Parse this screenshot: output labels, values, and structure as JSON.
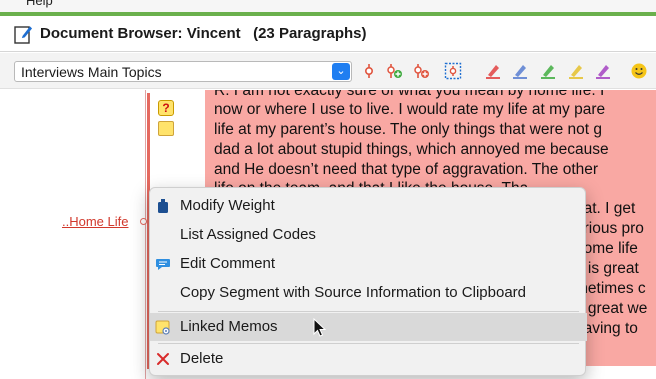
{
  "app_menu": {
    "label": "Help"
  },
  "window": {
    "title": "Document Browser: Vincent   (23 Paragraphs)"
  },
  "toolbar": {
    "code_system_select": "Interviews Main Topics",
    "highlight_colors": [
      "#e45b5b",
      "#6f8fd6",
      "#5cb85c",
      "#e7c84a",
      "#b05cc9"
    ]
  },
  "document": {
    "lines": [
      "R: I am not exactly sure of what you mean by home life. I",
      "now or where I use to live. I would rate my life at my pare",
      "life at my parent’s house. The only things that were not g",
      "dad a lot about stupid things, which annoyed me because",
      "and He doesn’t need that type of aggravation. The other",
      "life on the team, and that I like the house. Tha",
      "eat. I get",
      "erious pro",
      "home life",
      "e is great",
      "metimes c",
      "g great we",
      "having to"
    ],
    "highlight_color": "#f9a8a3",
    "code_label": "..Home Life"
  },
  "context_menu": {
    "items": [
      {
        "label": "Modify Weight",
        "icon": "weight-icon"
      },
      {
        "label": "List Assigned Codes",
        "icon": ""
      },
      {
        "label": "Edit Comment",
        "icon": "comment-icon"
      },
      {
        "label": "Copy Segment with Source Information to Clipboard",
        "icon": ""
      },
      {
        "label": "Linked Memos",
        "icon": "linked-memo-icon",
        "highlighted": true
      },
      {
        "label": "Delete",
        "icon": "delete-x-icon"
      }
    ]
  }
}
